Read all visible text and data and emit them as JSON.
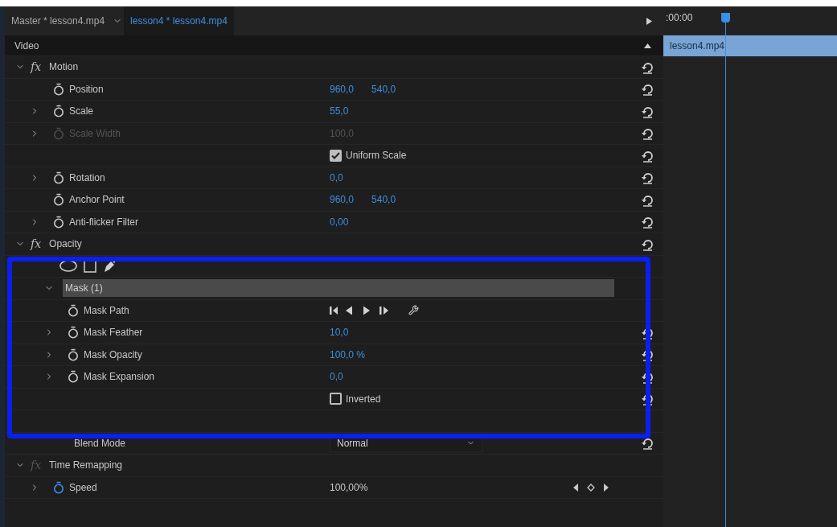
{
  "tabs": [
    {
      "label": "Master * lesson4.mp4",
      "selected": false
    },
    {
      "label": "lesson4 * lesson4.mp4",
      "selected": true
    }
  ],
  "timeline": {
    "timecode": ":00:00",
    "clip": "lesson4.mp4"
  },
  "section": "Video",
  "effects": [
    {
      "kind": "effect",
      "badge": "fx",
      "label": "Motion",
      "expanded": true,
      "fx_enabled": true,
      "reset": true,
      "children": [
        {
          "kind": "property",
          "label": "Position",
          "expandable": false,
          "values": [
            "960,0",
            "540,0"
          ],
          "scrubbable": true,
          "reset": true
        },
        {
          "kind": "property",
          "label": "Scale",
          "expandable": true,
          "values": [
            "55,0"
          ],
          "scrubbable": true,
          "reset": true
        },
        {
          "kind": "property",
          "label": "Scale Width",
          "expandable": true,
          "values": [
            "100,0"
          ],
          "disabled": true,
          "scrubbable": true,
          "reset": true
        },
        {
          "kind": "checkbox",
          "label": "Uniform Scale",
          "checked": true,
          "reset": true
        },
        {
          "kind": "property",
          "label": "Rotation",
          "expandable": true,
          "values": [
            "0,0"
          ],
          "scrubbable": true,
          "reset": true
        },
        {
          "kind": "property",
          "label": "Anchor Point",
          "expandable": false,
          "values": [
            "960,0",
            "540,0"
          ],
          "scrubbable": true,
          "reset": true
        },
        {
          "kind": "property",
          "label": "Anti-flicker Filter",
          "expandable": true,
          "values": [
            "0,00"
          ],
          "scrubbable": true,
          "reset": true
        }
      ]
    },
    {
      "kind": "effect",
      "badge": "fx",
      "label": "Opacity",
      "expanded": true,
      "fx_enabled": true,
      "reset": true,
      "children": [
        {
          "kind": "mask_tools"
        },
        {
          "kind": "mask",
          "label": "Mask (1)",
          "expanded": true,
          "children": [
            {
              "kind": "mask_path",
              "label": "Mask Path"
            },
            {
              "kind": "property",
              "label": "Mask Feather",
              "expandable": true,
              "values": [
                "10,0"
              ],
              "scrubbable": true,
              "reset": true
            },
            {
              "kind": "property",
              "label": "Mask Opacity",
              "expandable": true,
              "values": [
                "100,0 %"
              ],
              "scrubbable": true,
              "reset": true
            },
            {
              "kind": "property",
              "label": "Mask Expansion",
              "expandable": true,
              "values": [
                "0,0"
              ],
              "scrubbable": true,
              "reset": true
            },
            {
              "kind": "checkbox",
              "label": "Inverted",
              "checked": false,
              "reset": true
            }
          ]
        },
        {
          "kind": "covered"
        },
        {
          "kind": "dropdown",
          "label": "Blend Mode",
          "value": "Normal",
          "reset": true
        }
      ]
    },
    {
      "kind": "effect",
      "badge": "fx",
      "label": "Time Remapping",
      "expanded": true,
      "fx_enabled": false,
      "reset": false,
      "children": [
        {
          "kind": "property",
          "label": "Speed",
          "expandable": true,
          "values": [
            "100,00%"
          ],
          "scrubbable": false,
          "animating": true,
          "keyframe_nav": true,
          "reset": false
        }
      ]
    }
  ],
  "annotation": {
    "kind": "highlight_frame"
  }
}
